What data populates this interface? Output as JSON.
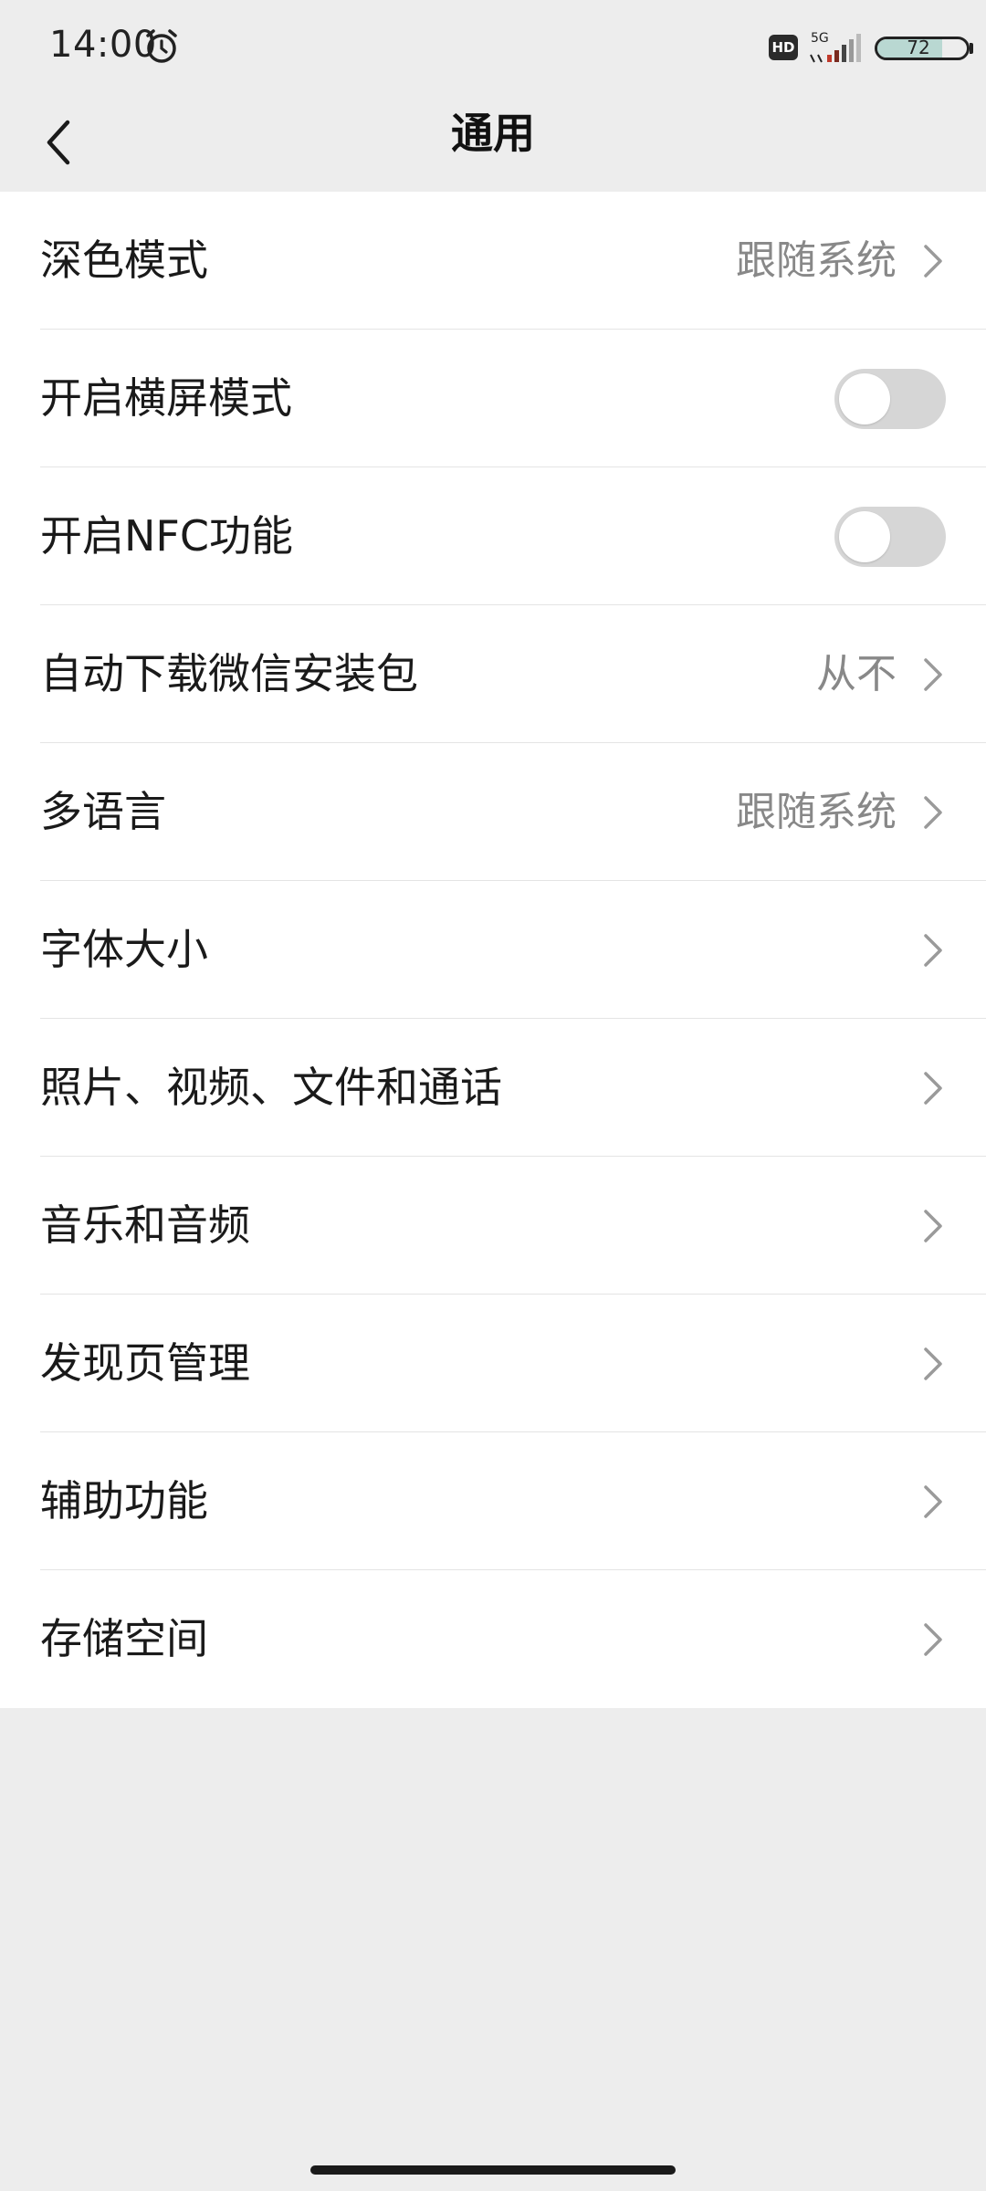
{
  "status_bar": {
    "time": "14:00",
    "network": "5G",
    "hd_badge": "HD",
    "battery": "72",
    "battery_level": 0.72
  },
  "header": {
    "title": "通用"
  },
  "settings": [
    {
      "label": "深色模式",
      "value": "跟随系统",
      "type": "link"
    },
    {
      "label": "开启横屏模式",
      "type": "toggle",
      "on": false
    },
    {
      "label": "开启NFC功能",
      "type": "toggle",
      "on": false
    },
    {
      "label": "自动下载微信安装包",
      "value": "从不",
      "type": "link"
    },
    {
      "label": "多语言",
      "value": "跟随系统",
      "type": "link"
    },
    {
      "label": "字体大小",
      "type": "link"
    },
    {
      "label": "照片、视频、文件和通话",
      "type": "link"
    },
    {
      "label": "音乐和音频",
      "type": "link"
    },
    {
      "label": "发现页管理",
      "type": "link"
    },
    {
      "label": "辅助功能",
      "type": "link"
    },
    {
      "label": "存储空间",
      "type": "link"
    }
  ]
}
